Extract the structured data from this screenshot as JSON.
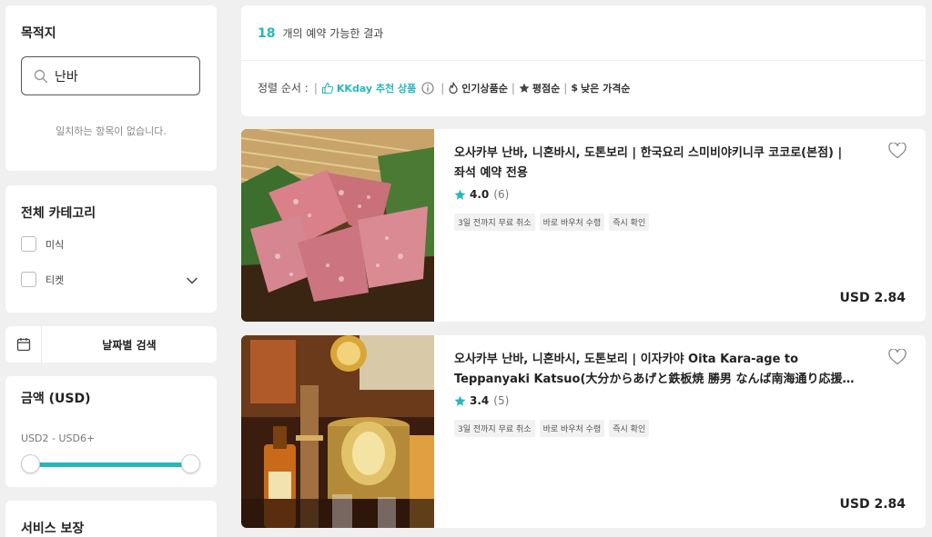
{
  "sidebar": {
    "destination": {
      "title": "목적지",
      "search_value": "난바",
      "no_match": "일치하는 항목이 없습니다."
    },
    "category": {
      "title": "전체 카테고리",
      "items": [
        {
          "label": "미식"
        },
        {
          "label": "티켓"
        }
      ]
    },
    "date_search": {
      "label": "날짜별 검색"
    },
    "price": {
      "title": "금액 (USD)",
      "range": "USD2 - USD6+",
      "slider_min_fraction": 0,
      "slider_max_fraction": 1
    },
    "service": {
      "title": "서비스 보장"
    }
  },
  "results": {
    "count": "18",
    "label": "개의 예약 가능한 결과"
  },
  "sort": {
    "label": "정렬 순서 :",
    "options": [
      {
        "label": "KKday 추천 상품",
        "icon": "thumbs-up-icon",
        "active": true
      },
      {
        "label": "인기상품순",
        "icon": "fire-icon"
      },
      {
        "label": "평점순",
        "icon": "star-icon"
      },
      {
        "label": "낮은 가격순",
        "icon": "dollar-icon"
      }
    ]
  },
  "products": [
    {
      "title_line1": "오사카부 난바, 니혼바시, 도톤보리 | 한국요리 스미비야키니쿠 코코로(본점) |",
      "title_line2": "좌석 예약 전용",
      "rating": "4.0",
      "reviews": "(6)",
      "tags": [
        "3일 전까지 무료 취소",
        "바로 바우처 수령",
        "즉시 확인"
      ],
      "price": "USD 2.84"
    },
    {
      "title_line1": "오사카부 난바, 니혼바시, 도톤보리 | 이자카야 Oita Kara-age to",
      "title_line2": "Teppanyaki Katsuo(大分からあげと鉄板焼 勝男 なんば南海通り応援…",
      "rating": "3.4",
      "reviews": "(5)",
      "tags": [
        "3일 전까지 무료 취소",
        "바로 바우처 수령",
        "즉시 확인"
      ],
      "price": "USD 2.84"
    }
  ],
  "colors": {
    "accent": "#26b7bc",
    "star": "#26b7bc",
    "background": "#f0f0f0"
  }
}
